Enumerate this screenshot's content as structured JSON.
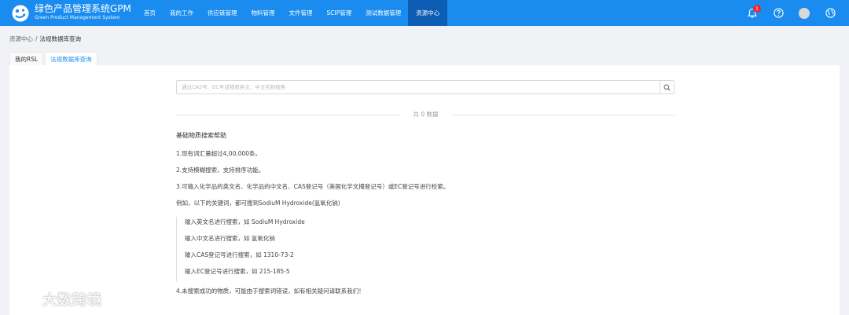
{
  "brand": {
    "title": "绿色产品管理系统GPM",
    "subtitle": "Green Product Management System"
  },
  "nav": {
    "items": [
      "首页",
      "我的工作",
      "供应链管理",
      "物料管理",
      "文件管理",
      "SCIP管理",
      "测试数据管理",
      "资源中心"
    ],
    "active_index": 7
  },
  "header_icons": {
    "notifications_count": "1",
    "icons": [
      "bell-icon",
      "help-icon",
      "avatar",
      "globe-icon"
    ]
  },
  "breadcrumb": {
    "root": "资源中心",
    "separator": "/",
    "current": "法规数据库查询"
  },
  "tabs": [
    "我的RSL",
    "法规数据库查询"
  ],
  "search": {
    "placeholder": "通过CAS号、EC号或物质英文、中文名称搜索",
    "value": ""
  },
  "results": {
    "count_text": "共 0 数据"
  },
  "help": {
    "title": "基础物质搜索帮助",
    "lines": [
      "1.现有词汇量超过4,00,000条。",
      "2.支持模糊搜索，支持排序功能。",
      "3.可输入化学品的英文名、化学品的中文名、CAS登记号（美国化学文摘登记号）或EC登记号进行检索。",
      "例如，以下的关键词，都可搜到SodiuM Hydroxide(氢氧化钠)"
    ],
    "examples": [
      "输入英文名进行搜索，如 SodiuM Hydroxide",
      "输入中文名进行搜索，如 氢氧化钠",
      "输入CAS登记号进行搜索，如 1310-73-2",
      "输入EC登记号进行搜索，如 215-185-5"
    ],
    "footer": "4.未搜索成功的物质，可能由于搜索词错误，如有相关疑问请联系我们！"
  },
  "watermark": {
    "text": "大数跨境"
  },
  "colors": {
    "header_bg": "#1a8cf0",
    "nav_active_bg": "#0c5db3",
    "badge": "#f5222d",
    "tab_active_text": "#1a8cf0"
  }
}
